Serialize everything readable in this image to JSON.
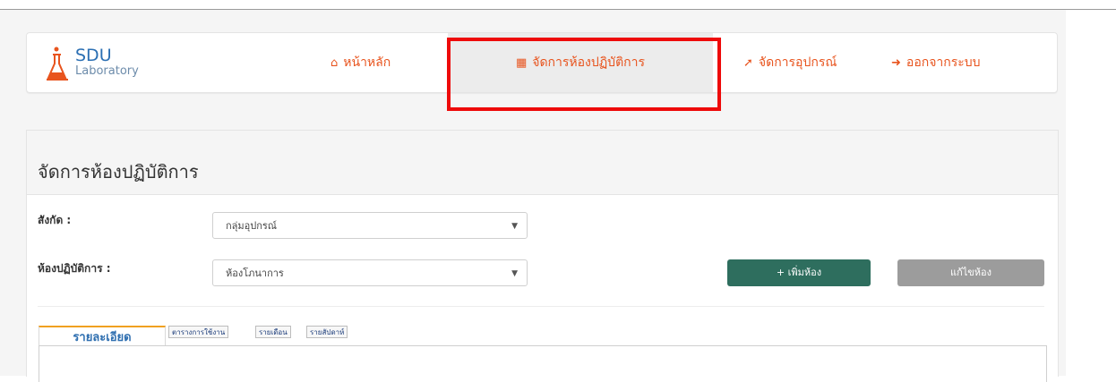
{
  "brand": {
    "line1": "SDU",
    "line2": "Laboratory",
    "icon": "flask-icon"
  },
  "nav": {
    "home": {
      "label": "หน้าหลัก",
      "icon": "home-icon"
    },
    "labs": {
      "label": "จัดการห้องปฏิบัติการ",
      "icon": "building-icon"
    },
    "equipment": {
      "label": "จัดการอุปกรณ์",
      "icon": "wrench-icon"
    },
    "logout": {
      "label": "ออกจากระบบ",
      "icon": "sign-out-icon"
    }
  },
  "page": {
    "title": "จัดการห้องปฏิบัติการ"
  },
  "form": {
    "affiliation_label": "สังกัด :",
    "affiliation_value": "กลุ่มอุปกรณ์",
    "lab_label": "ห้องปฏิบัติการ :",
    "lab_value": "ห้องโภนาการ"
  },
  "buttons": {
    "add": "+ เพิ่มห้อง",
    "edit": "แก้ไขห้อง"
  },
  "tabs": {
    "details": "รายละเอียด",
    "schedule": "ตารางการใช้งาน",
    "monthly": "รายเดือน",
    "weekly": "รายสัปดาห์"
  },
  "colors": {
    "accent": "#e8541e",
    "brand": "#2b6fb3",
    "add_button": "#2e6e5e",
    "edit_button": "#9c9c9c",
    "highlight": "#ee0a0a"
  }
}
